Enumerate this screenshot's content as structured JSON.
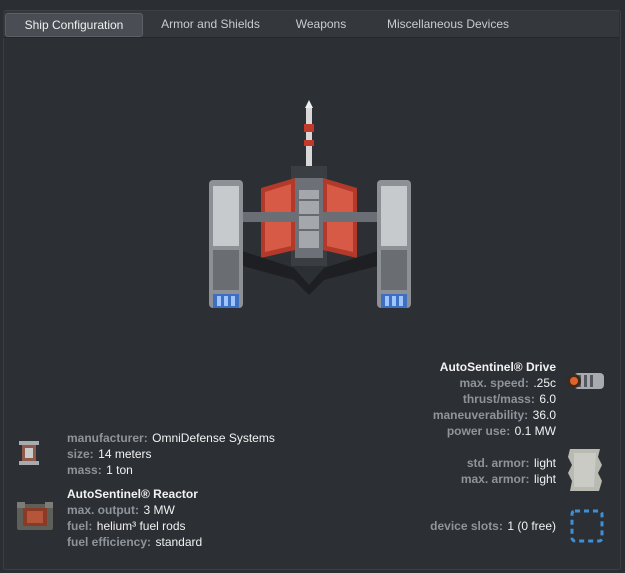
{
  "tabs": [
    "Ship Configuration",
    "Armor and Shields",
    "Weapons",
    "Miscellaneous Devices"
  ],
  "ship_image": "ship-icon",
  "drive": {
    "title": "AutoSentinel® Drive",
    "rows": [
      {
        "label": "max. speed:",
        "value": ".25c"
      },
      {
        "label": "thrust/mass:",
        "value": "6.0"
      },
      {
        "label": "maneuverability:",
        "value": "36.0"
      },
      {
        "label": "power use:",
        "value": "0.1 MW"
      }
    ],
    "icon": "drive-icon"
  },
  "armor": {
    "rows": [
      {
        "label": "std. armor:",
        "value": "light"
      },
      {
        "label": "max. armor:",
        "value": "light"
      }
    ],
    "icon": "armor-plate-icon"
  },
  "devices": {
    "label": "device slots:",
    "value": "1 (0 free)",
    "icon": "empty-slot-icon"
  },
  "hull": {
    "rows": [
      {
        "label": "manufacturer:",
        "value": "OmniDefense Systems"
      },
      {
        "label": "size:",
        "value": "14 meters"
      },
      {
        "label": "mass:",
        "value": "1 ton"
      }
    ],
    "icon": "hull-icon"
  },
  "reactor": {
    "title": "AutoSentinel® Reactor",
    "rows": [
      {
        "label": "max. output:",
        "value": "3 MW"
      },
      {
        "label": "fuel:",
        "value": "helium³ fuel rods"
      },
      {
        "label": "fuel efficiency:",
        "value": "standard"
      }
    ],
    "icon": "reactor-icon"
  }
}
